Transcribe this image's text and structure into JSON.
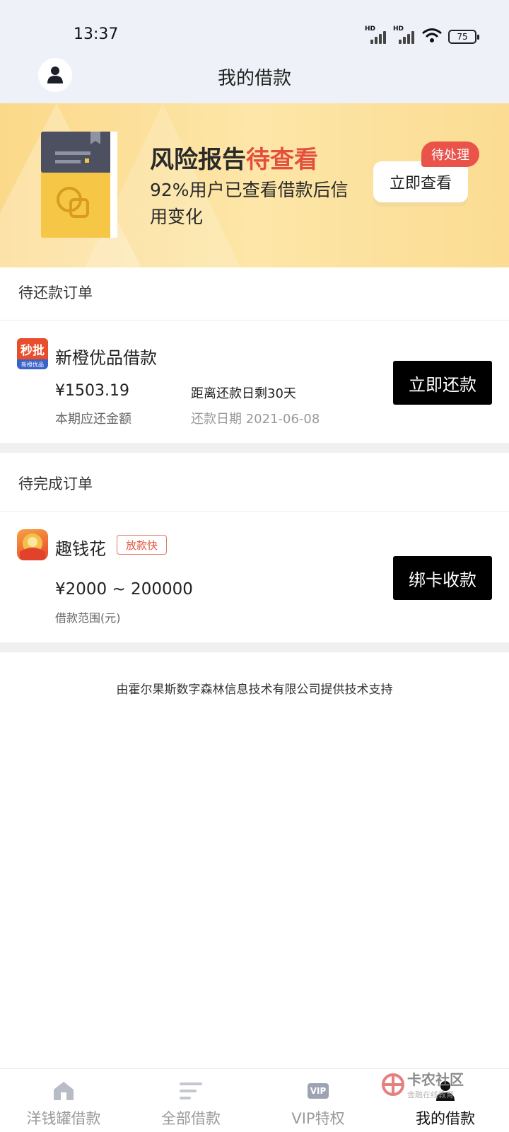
{
  "status_bar": {
    "time": "13:37",
    "signal1_label": "HD",
    "signal2_label": "HD",
    "battery": "75"
  },
  "header": {
    "title": "我的借款"
  },
  "banner": {
    "title_prefix": "风险报告",
    "title_highlight": "待查看",
    "subtitle": "92%用户已查看借款后信用变化",
    "button_label": "立即查看",
    "badge": "待处理",
    "highlight_color": "#e4503f"
  },
  "repay_section": {
    "title": "待还款订单",
    "order": {
      "name": "新橙优品借款",
      "logo_text": "秒批",
      "logo_subtext": "新橙优品",
      "amount": "¥1503.19",
      "amount_caption": "本期应还金额",
      "due_info": "距离还款日剩30天",
      "due_date": "还款日期 2021-06-08",
      "button_label": "立即还款"
    }
  },
  "complete_section": {
    "title": "待完成订单",
    "order": {
      "name": "趣钱花",
      "tag": "放款快",
      "amount_range": "¥2000 ~ 200000",
      "range_caption": "借款范围(元)",
      "button_label": "绑卡收款"
    }
  },
  "footer": {
    "support_text": "由霍尔果斯数字森林信息技术有限公司提供技术支持"
  },
  "tabbar": {
    "tabs": [
      {
        "label": "洋钱罐借款",
        "icon": "home-icon",
        "active": false
      },
      {
        "label": "全部借款",
        "icon": "list-icon",
        "active": false
      },
      {
        "label": "VIP特权",
        "icon": "vip-icon",
        "active": false
      },
      {
        "label": "我的借款",
        "icon": "user-icon",
        "active": true
      }
    ],
    "vip_icon_text": "VIP"
  },
  "watermark": {
    "title": "卡农社区",
    "subtitle": "金融在线教育"
  }
}
